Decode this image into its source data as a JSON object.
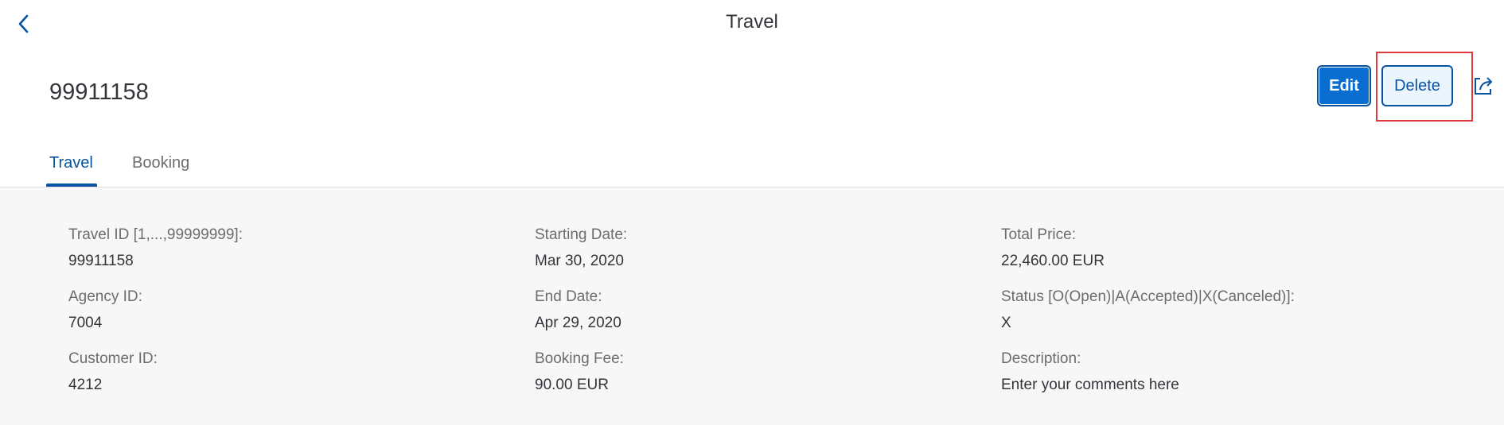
{
  "shell": {
    "title": "Travel",
    "back_icon": "chevron-left-icon"
  },
  "header": {
    "object_title": "99911158",
    "edit_label": "Edit",
    "delete_label": "Delete",
    "share_icon": "share-icon"
  },
  "tabs": [
    {
      "label": "Travel",
      "selected": true
    },
    {
      "label": "Booking",
      "selected": false
    }
  ],
  "fields": {
    "travel_id": {
      "label": "Travel ID [1,...,99999999]:",
      "value": "99911158"
    },
    "agency_id": {
      "label": "Agency ID:",
      "value": "7004"
    },
    "customer_id": {
      "label": "Customer ID:",
      "value": "4212"
    },
    "starting_date": {
      "label": "Starting Date:",
      "value": "Mar 30, 2020"
    },
    "end_date": {
      "label": "End Date:",
      "value": "Apr 29, 2020"
    },
    "booking_fee": {
      "label": "Booking Fee:",
      "value": "90.00  EUR"
    },
    "total_price": {
      "label": "Total Price:",
      "value": "22,460.00  EUR"
    },
    "status": {
      "label": "Status [O(Open)|A(Accepted)|X(Canceled)]:",
      "value": "X"
    },
    "description": {
      "label": "Description:",
      "value": "Enter your comments here"
    }
  },
  "colors": {
    "accent": "#0854a0",
    "button_emphasized": "#0a6ed1",
    "highlight": "#e0393e",
    "content_bg": "#f7f7f7"
  }
}
